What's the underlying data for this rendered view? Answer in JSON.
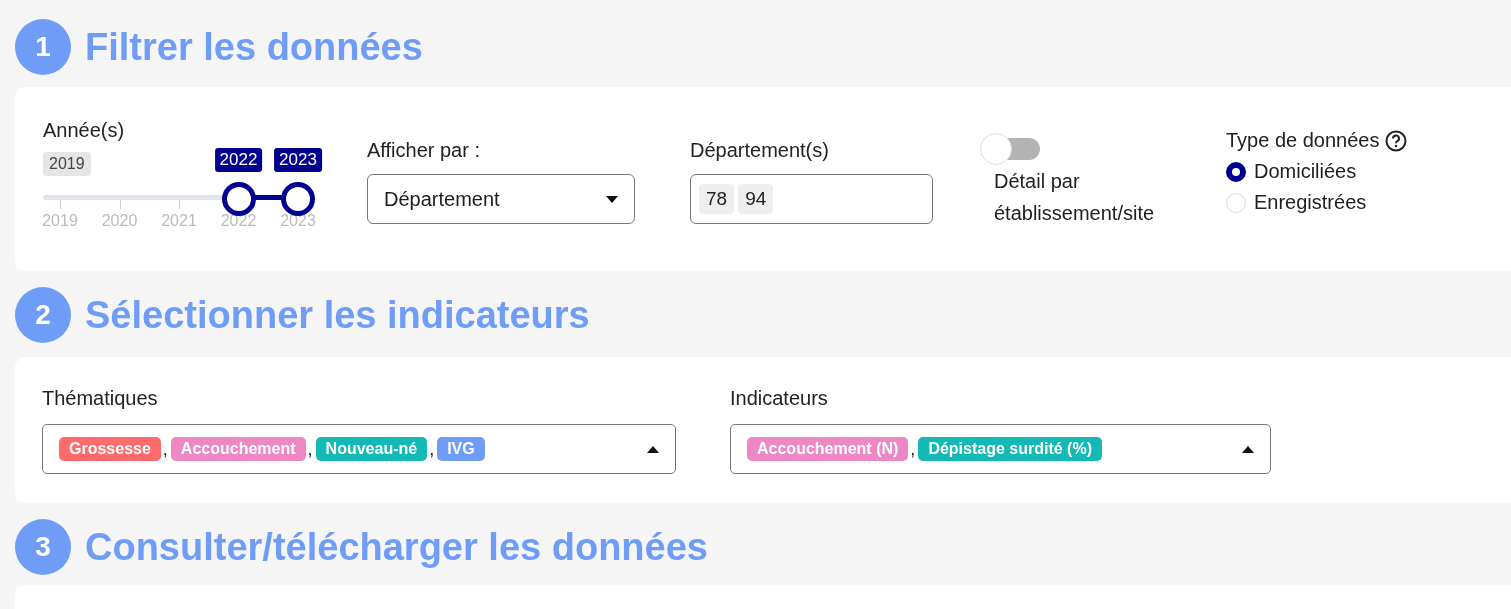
{
  "sections": [
    {
      "number": "1",
      "title": "Filtrer les données"
    },
    {
      "number": "2",
      "title": "Sélectionner les indicateurs"
    },
    {
      "number": "3",
      "title": "Consulter/télécharger les données"
    }
  ],
  "filters": {
    "years": {
      "label": "Année(s)",
      "min_label": "2019",
      "ticks": [
        "2019",
        "2020",
        "2021",
        "2022",
        "2023"
      ],
      "handles": [
        {
          "label": "2022",
          "level": 0.75
        },
        {
          "label": "2023",
          "level": 1.0
        }
      ]
    },
    "display_by": {
      "label": "Afficher par :",
      "value": "Département"
    },
    "departments": {
      "label": "Département(s)",
      "chips": [
        "78",
        "94"
      ]
    },
    "detail_toggle": {
      "label": "Détail par établissement/site",
      "on": false
    },
    "data_type": {
      "label": "Type de données",
      "options": [
        {
          "label": "Domiciliées",
          "selected": true
        },
        {
          "label": "Enregistrées",
          "selected": false
        }
      ]
    }
  },
  "indicators": {
    "separator": ",",
    "fields": [
      {
        "label": "Thématiques",
        "tags": [
          {
            "text": "Grossesse",
            "color": "#ff6b6b"
          },
          {
            "text": "Accouchement",
            "color": "#ee88c4"
          },
          {
            "text": "Nouveau-né",
            "color": "#13b9b5"
          },
          {
            "text": "IVG",
            "color": "#6e9cf7"
          }
        ]
      },
      {
        "label": "Indicateurs",
        "tags": [
          {
            "text": "Accouchement (N)",
            "color": "#ee88c4"
          },
          {
            "text": "Dépistage surdité (%)",
            "color": "#13b9b5"
          }
        ]
      }
    ]
  }
}
